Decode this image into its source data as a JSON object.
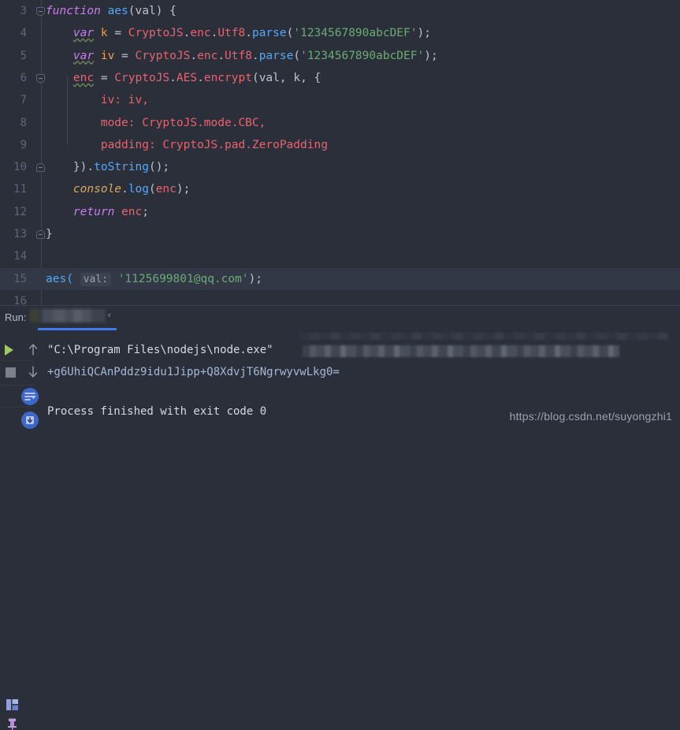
{
  "editor": {
    "first_visible_line": 3,
    "current_line": 15,
    "lines": [
      {
        "n": 3,
        "fold": "start",
        "indent": 0
      },
      {
        "n": 4,
        "fold": null,
        "indent": 1
      },
      {
        "n": 5,
        "fold": null,
        "indent": 1
      },
      {
        "n": 6,
        "fold": "start",
        "indent": 1
      },
      {
        "n": 7,
        "fold": null,
        "indent": 2
      },
      {
        "n": 8,
        "fold": null,
        "indent": 2
      },
      {
        "n": 9,
        "fold": null,
        "indent": 2
      },
      {
        "n": 10,
        "fold": "end",
        "indent": 1
      },
      {
        "n": 11,
        "fold": null,
        "indent": 1
      },
      {
        "n": 12,
        "fold": null,
        "indent": 1
      },
      {
        "n": 13,
        "fold": "end",
        "indent": 0
      },
      {
        "n": 14,
        "fold": null,
        "indent": 0
      },
      {
        "n": 15,
        "fold": null,
        "indent": 0
      },
      {
        "n": 16,
        "fold": null,
        "indent": 0
      }
    ],
    "source_text": [
      "function aes(val) {",
      "    var k = CryptoJS.enc.Utf8.parse('1234567890abcDEF');",
      "    var iv = CryptoJS.enc.Utf8.parse('1234567890abcDEF');",
      "    enc = CryptoJS.AES.encrypt(val, k, {",
      "        iv: iv,",
      "        mode: CryptoJS.mode.CBC,",
      "        padding: CryptoJS.pad.ZeroPadding",
      "    }).toString();",
      "    console.log(enc);",
      "    return enc;",
      "}",
      "",
      "aes( val: '1125699801@qq.com');",
      ""
    ],
    "tokens": {
      "kw_function": "function",
      "fn_aes": "aes",
      "paren_open_val": "(val) {",
      "kw_var": "var",
      "ident_k": "k",
      "eq": " = ",
      "obj_cryptojs": "CryptoJS",
      "dot": ".",
      "prop_enc_ns": "enc",
      "prop_utf8": "Utf8",
      "fn_parse": "parse",
      "str_key": "'1234567890abcDEF'",
      "ident_iv": "iv",
      "ident_enc": "enc",
      "prop_aes": "AES",
      "fn_encrypt": "encrypt",
      "arg_val": "val",
      "arg_k": "k",
      "key_iv": "iv:",
      "key_mode": "mode:",
      "val_mode": "CryptoJS.mode.CBC,",
      "key_padding": "padding:",
      "val_padding": "CryptoJS.pad.ZeroPadding",
      "close_tostring": "}).",
      "fn_tostring": "toString",
      "obj_console": "console",
      "fn_log": "log",
      "kw_return": "return",
      "brace_close": "}",
      "call_aes": "aes(",
      "param_hint": "val:",
      "str_email": "'1125699801@qq.com'",
      "tail": ");",
      "semi": ";",
      "comma": ",",
      "paren_close": ")"
    }
  },
  "run_panel": {
    "label": "Run:",
    "tab_name_redacted": true,
    "tab_caret": "‹",
    "toolbar": {
      "rerun": "rerun-icon",
      "stop": "stop-icon",
      "up": "up-arrow-icon",
      "down": "down-arrow-icon",
      "soft_wrap": "soft-wrap-icon",
      "scroll_to_end": "scroll-to-end-icon",
      "layout": "layout-grid-icon",
      "pin": "pin-icon"
    },
    "console": {
      "command_line": "\"C:\\Program Files\\nodejs\\node.exe\"",
      "command_line_redacted_tail": true,
      "output_line": "+g6UhiQCAnPddz9idu1Jipp+Q8XdvjT6NgrwyvwLkg0=",
      "status_line": "Process finished with exit code 0"
    }
  },
  "watermark": {
    "text": "https://blog.csdn.net/suyongzhi1"
  },
  "colors": {
    "bg_editor": "#2b2f3a",
    "bg_current_line": "#323846",
    "gutter_text": "#606673",
    "keyword": "#cc7df0",
    "function": "#56a8f5",
    "property": "#e8636f",
    "string": "#6aab73",
    "field": "#e8a24a",
    "plain": "#bdc3ce",
    "accent_blue": "#3d7cf0",
    "run_green": "#9fc966",
    "console_text": "#d5d9e0",
    "console_blue": "#a5b9d6",
    "warning_squiggle": "#6a8759"
  }
}
